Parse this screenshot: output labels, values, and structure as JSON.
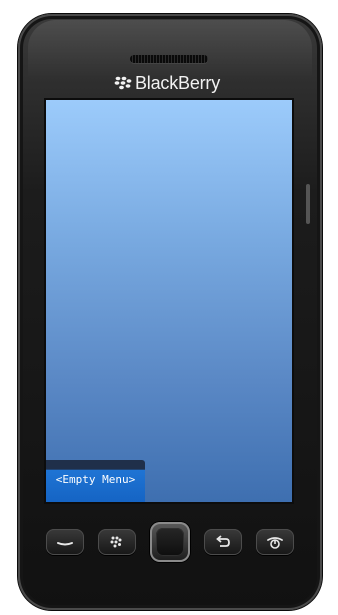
{
  "device": {
    "brand_label": "BlackBerry"
  },
  "screen": {
    "menu": {
      "label": "<Empty Menu>"
    },
    "background_top": "#9ccbfb",
    "background_bottom": "#3e6fb0",
    "menu_color": "#1564c4"
  },
  "keys": {
    "items": [
      {
        "name": "call-key",
        "icon": "phone-icon"
      },
      {
        "name": "menu-key",
        "icon": "blackberry-menu-icon"
      },
      {
        "name": "trackpad",
        "icon": "trackpad"
      },
      {
        "name": "back-key",
        "icon": "back-arrow-icon"
      },
      {
        "name": "end-key",
        "icon": "power-icon"
      }
    ]
  }
}
